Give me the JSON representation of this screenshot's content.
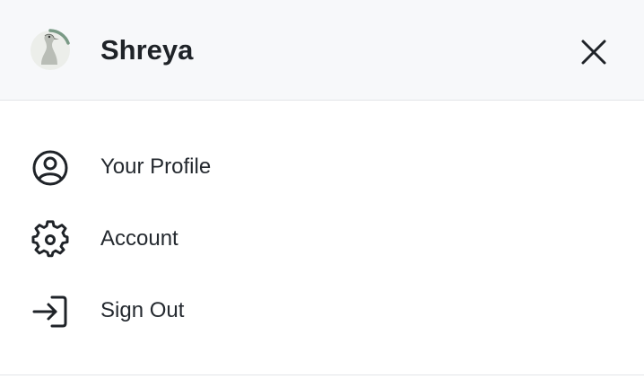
{
  "user": {
    "name": "Shreya",
    "avatar_icon": "ostrich-avatar-icon",
    "status_ring_color": "#7a9a86"
  },
  "header": {
    "close_icon": "close-icon"
  },
  "menu": {
    "items": [
      {
        "label": "Your Profile",
        "icon": "user-circle-icon"
      },
      {
        "label": "Account",
        "icon": "gear-icon"
      },
      {
        "label": "Sign Out",
        "icon": "sign-out-icon"
      }
    ]
  },
  "colors": {
    "header_bg": "#f7f8fa",
    "text": "#24292f",
    "divider": "#e3e5e8"
  }
}
